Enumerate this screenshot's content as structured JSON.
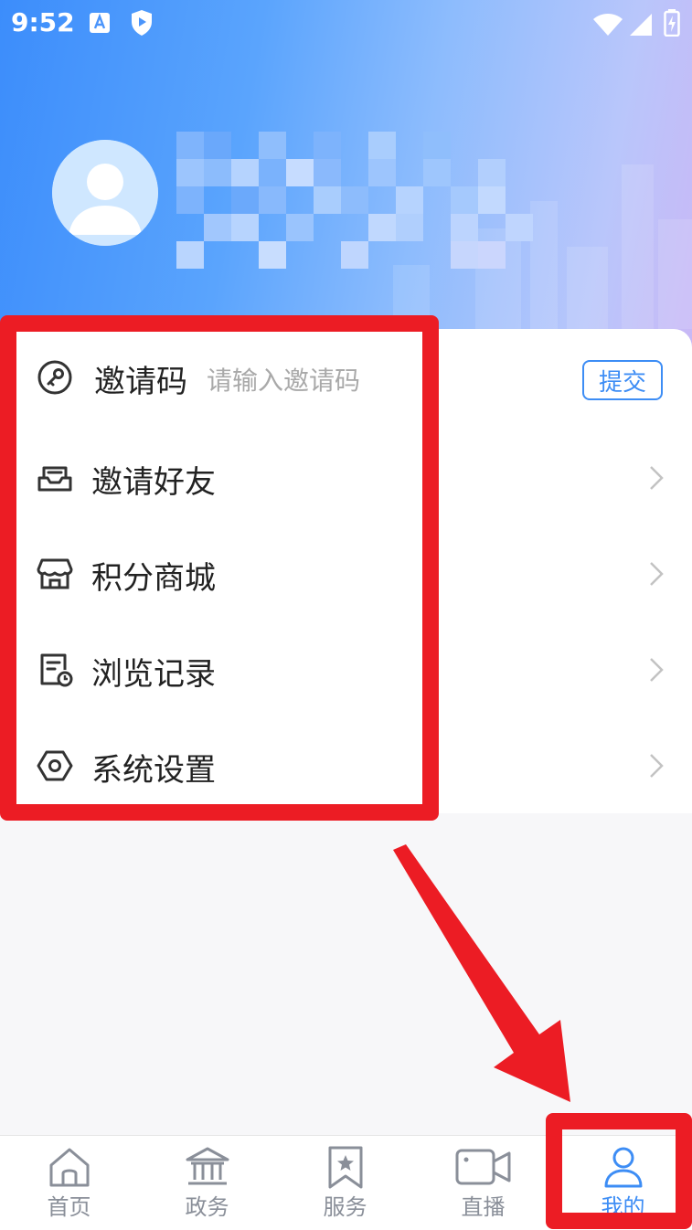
{
  "status_bar": {
    "time": "9:52"
  },
  "profile": {
    "avatar": "avatar-icon"
  },
  "menu": {
    "invite_code": {
      "label": "邀请码",
      "input_placeholder": "请输入邀请码",
      "submit_label": "提交",
      "icon": "key-icon"
    },
    "items": [
      {
        "label": "邀请好友",
        "icon": "mailbox-icon"
      },
      {
        "label": "积分商城",
        "icon": "store-icon"
      },
      {
        "label": "浏览记录",
        "icon": "history-icon"
      },
      {
        "label": "系统设置",
        "icon": "settings-hexagon-icon"
      }
    ]
  },
  "tabbar": {
    "tabs": [
      {
        "label": "首页",
        "icon": "home-icon"
      },
      {
        "label": "政务",
        "icon": "government-icon"
      },
      {
        "label": "服务",
        "icon": "service-bookmark-icon"
      },
      {
        "label": "直播",
        "icon": "video-camera-icon"
      },
      {
        "label": "我的",
        "icon": "user-icon",
        "active": true
      }
    ]
  },
  "colors": {
    "accent": "#3d8df5",
    "annotation": "#ec1c24",
    "header_start": "#3c8dfb",
    "header_end": "#c9b8f6"
  }
}
